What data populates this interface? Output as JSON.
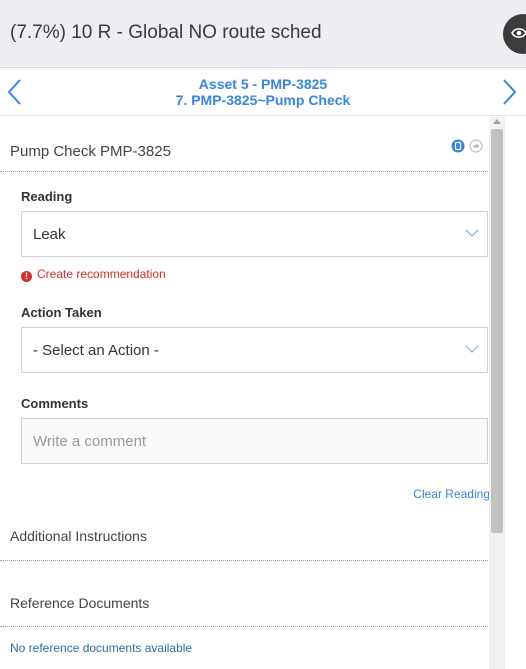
{
  "header": {
    "title": "(7.7%) 10 R - Global NO route sched",
    "eye_icon": "eye-icon"
  },
  "nav": {
    "asset": "Asset 5 - PMP-3825",
    "step": "7. PMP-3825~Pump Check",
    "prev_icon": "chevron-left-icon",
    "next_icon": "chevron-right-icon"
  },
  "checkpoint": {
    "title": "Pump Check PMP-3825",
    "device_icon": "device-icon",
    "cloud_icon": "cloud-icon"
  },
  "reading": {
    "label": "Reading",
    "value": "Leak",
    "error": "Create recommendation",
    "error_icon": "alert-icon"
  },
  "action": {
    "label": "Action Taken",
    "value": "- Select an Action -"
  },
  "comments": {
    "label": "Comments",
    "placeholder": "Write a comment"
  },
  "clear_reading": "Clear Reading",
  "additional_instructions": "Additional Instructions",
  "reference_documents": {
    "title": "Reference Documents",
    "empty": "No reference documents available"
  },
  "colors": {
    "accent": "#3a86d9",
    "error": "#d32f2f",
    "header_bg": "#eceef1"
  }
}
